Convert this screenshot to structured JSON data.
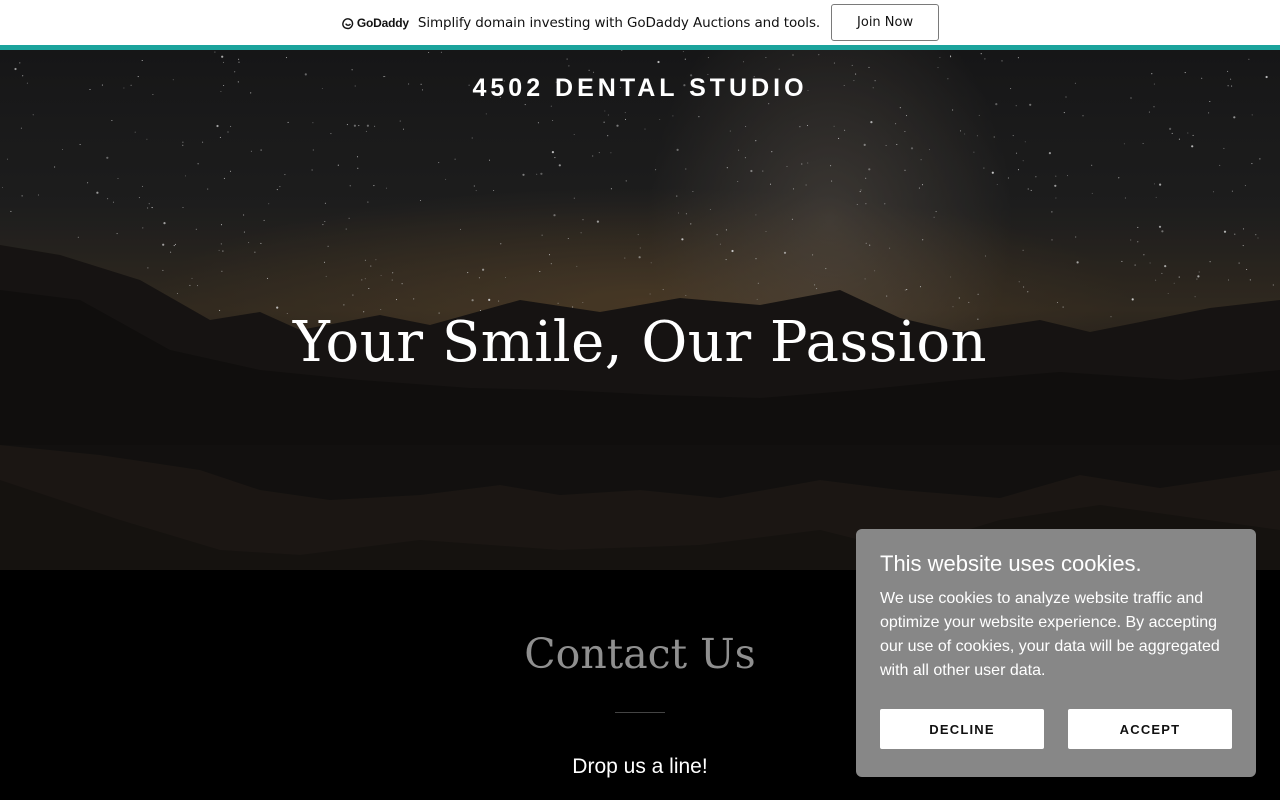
{
  "promo": {
    "logo_text": "GoDaddy",
    "message": "Simplify domain investing with GoDaddy Auctions and tools.",
    "cta_label": "Join Now",
    "accent_color": "#1ba39c"
  },
  "hero": {
    "site_title": "4502 DENTAL STUDIO",
    "headline": "Your Smile, Our Passion"
  },
  "contact": {
    "title": "Contact Us",
    "subtitle": "Drop us a line!"
  },
  "cookie_banner": {
    "title": "This website uses cookies.",
    "body": "We use cookies to analyze website traffic and optimize your website experience. By accepting our use of cookies, your data will be aggregated with all other user data.",
    "decline_label": "DECLINE",
    "accept_label": "ACCEPT",
    "background_color": "#878787"
  }
}
